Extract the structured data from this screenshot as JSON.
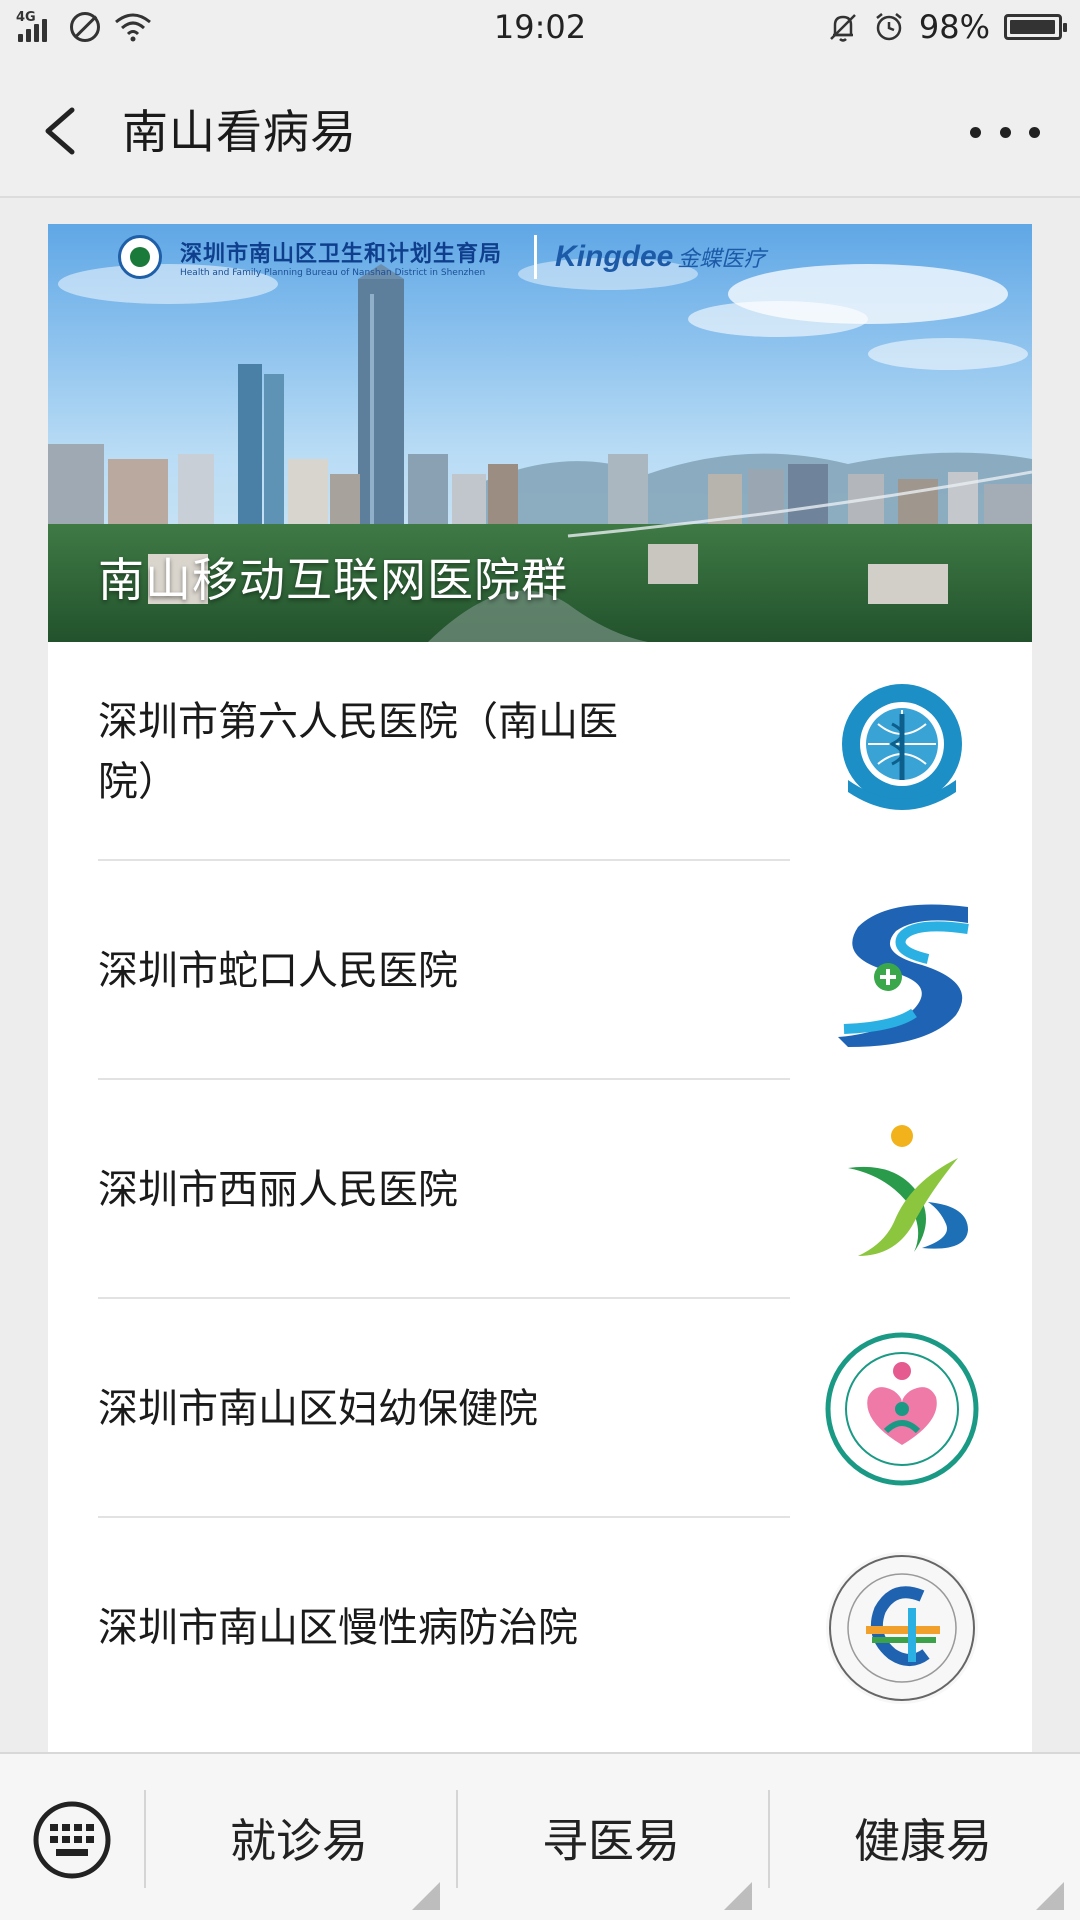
{
  "status_bar": {
    "network": "4G",
    "time": "19:02",
    "battery": "98%",
    "battery_level": 0.98
  },
  "nav": {
    "title": "南山看病易",
    "back_icon": "chevron-left-icon",
    "more_icon": "more-dots-icon"
  },
  "banner": {
    "bureau_cn": "深圳市南山区卫生和计划生育局",
    "bureau_en": "Health and Family Planning Bureau of Nanshan District in Shenzhen",
    "brand_en": "Kingdee",
    "brand_cn": "金蝶医疗",
    "title": "南山移动互联网医院群"
  },
  "hospitals": [
    {
      "name": "深圳市第六人民医院（南山医院）",
      "logo": "nanshan-hospital-logo"
    },
    {
      "name": "深圳市蛇口人民医院",
      "logo": "shekou-hospital-logo"
    },
    {
      "name": "深圳市西丽人民医院",
      "logo": "xili-hospital-logo"
    },
    {
      "name": "深圳市南山区妇幼保健院",
      "logo": "maternity-hospital-logo"
    },
    {
      "name": "深圳市南山区慢性病防治院",
      "logo": "chronic-disease-hospital-logo"
    }
  ],
  "bottom_bar": {
    "keyboard_icon": "keyboard-icon",
    "tabs": [
      "就诊易",
      "寻医易",
      "健康易"
    ]
  },
  "colors": {
    "background": "#ededed",
    "card": "#ffffff",
    "sky": "#9cc9ee",
    "logo_blue": "#1d7fc2",
    "logo_green": "#4aa63c"
  }
}
